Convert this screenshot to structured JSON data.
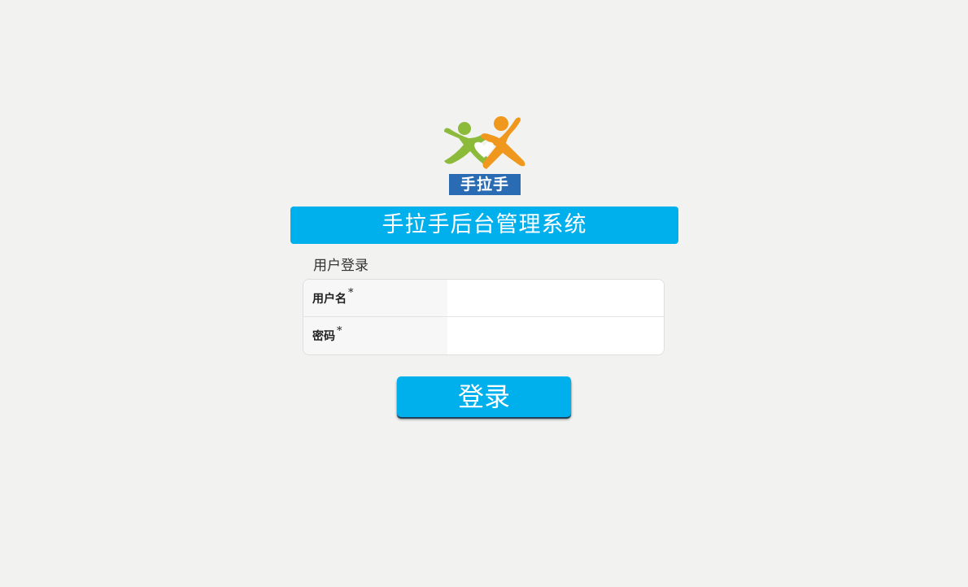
{
  "logo": {
    "icon": "hand-in-hand-logo-icon",
    "text": "手拉手",
    "colors": {
      "green": "#8cba3a",
      "orange": "#f0981e",
      "blue": "#2a6cb4"
    }
  },
  "header": {
    "title": "手拉手后台管理系统",
    "accent_color": "#00b0ec"
  },
  "login_form": {
    "section_title": "用户登录",
    "fields": [
      {
        "label": "用户名",
        "required_mark": "*",
        "value": "",
        "placeholder": ""
      },
      {
        "label": "密码",
        "required_mark": "*",
        "value": "",
        "placeholder": ""
      }
    ],
    "submit_label": "登录"
  }
}
